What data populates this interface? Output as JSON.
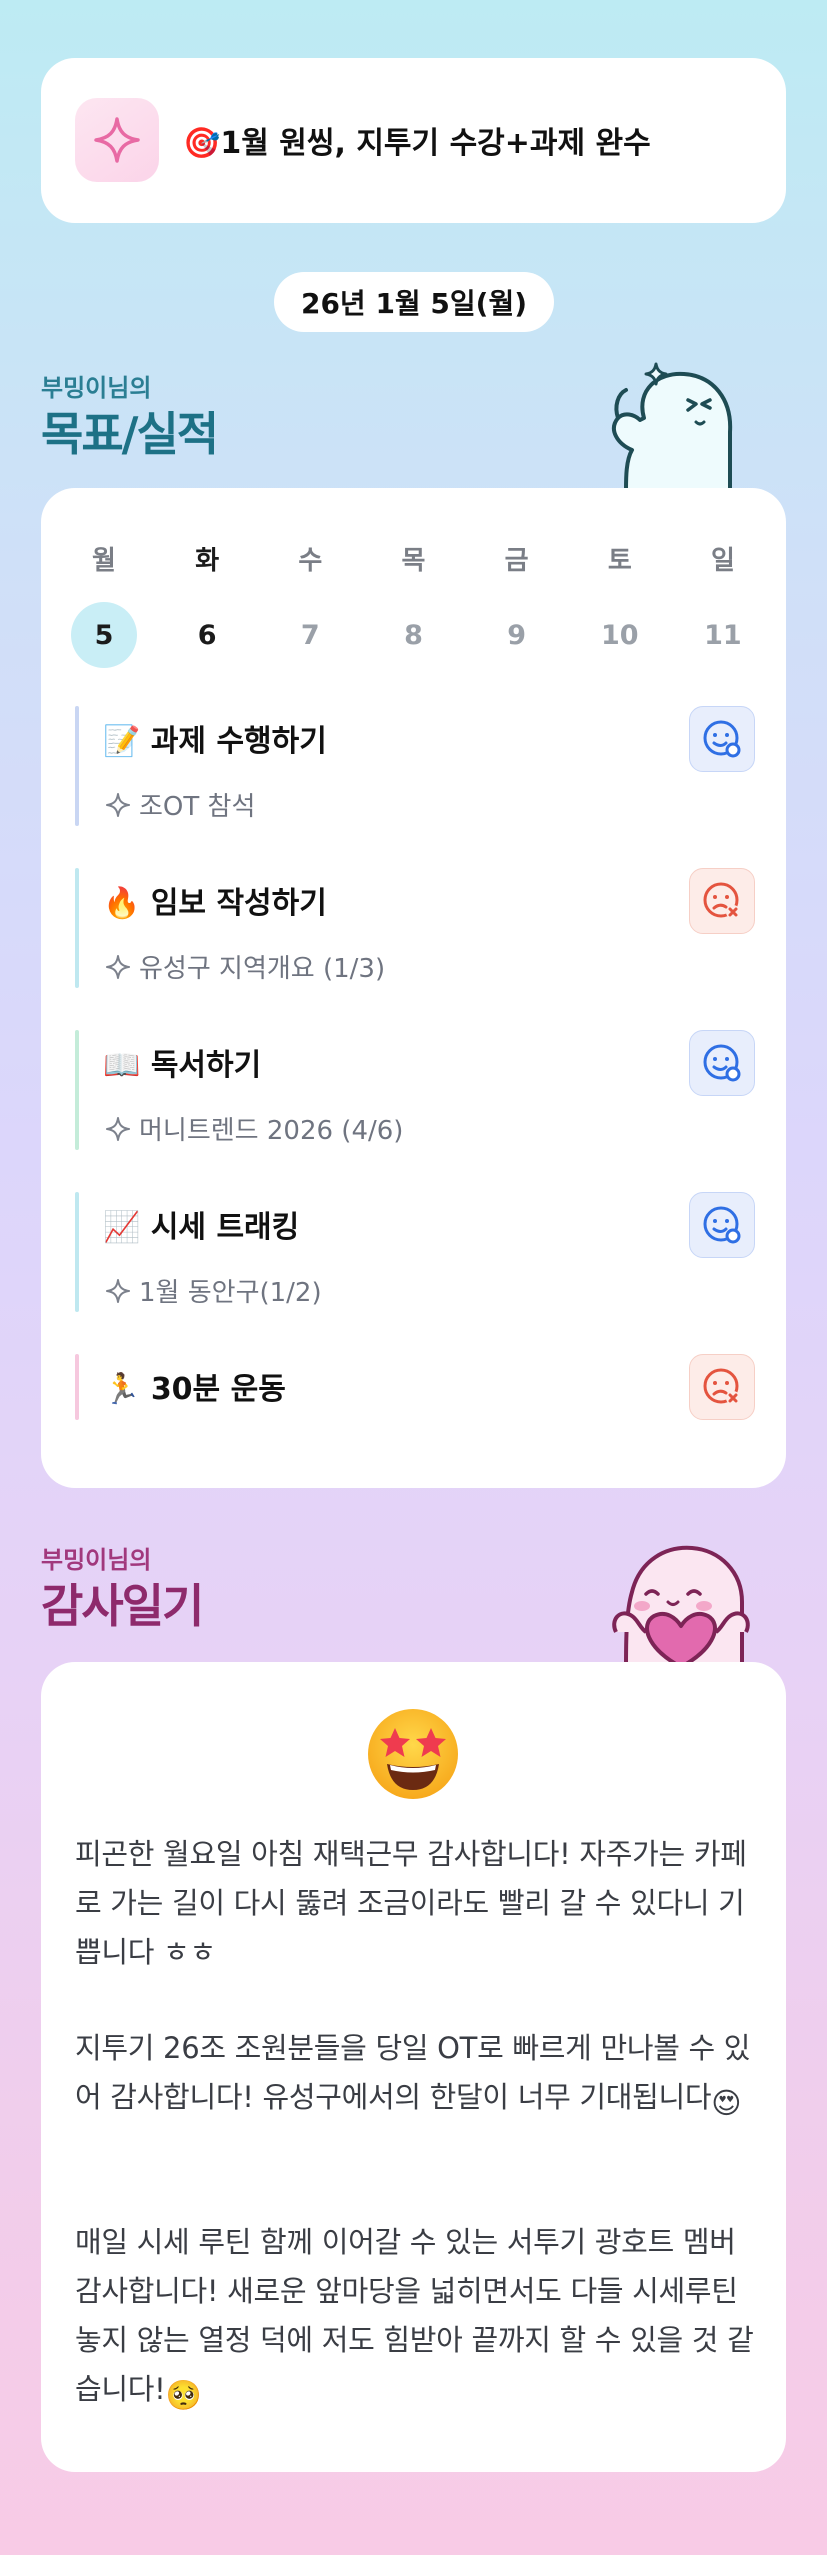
{
  "goal": {
    "icon": "sparkle-icon",
    "emoji": "🎯",
    "text": "1월 원씽, 지투기 수강+과제 완수"
  },
  "date": "26년 1월 5일(월)",
  "goals_section": {
    "owner": "부밍이님의",
    "title": "목표/실적"
  },
  "week": [
    {
      "day": "월",
      "date": "5"
    },
    {
      "day": "화",
      "date": "6"
    },
    {
      "day": "수",
      "date": "7"
    },
    {
      "day": "목",
      "date": "8"
    },
    {
      "day": "금",
      "date": "9"
    },
    {
      "day": "토",
      "date": "10"
    },
    {
      "day": "일",
      "date": "11"
    }
  ],
  "tasks": [
    {
      "emoji": "📝",
      "title": "과제 수행하기",
      "detail": "조OT 참석",
      "status": "success",
      "bar_color": "#c9d6f3"
    },
    {
      "emoji": "🔥",
      "title": "임보 작성하기",
      "detail": "유성구 지역개요 (1/3)",
      "status": "fail",
      "bar_color": "#bfe8f0"
    },
    {
      "emoji": "📖",
      "title": "독서하기",
      "detail": "머니트렌드 2026 (4/6)",
      "status": "success",
      "bar_color": "#c4ecd9"
    },
    {
      "emoji": "📈",
      "title": "시세 트래킹",
      "detail": "1월 동안구(1/2)",
      "status": "success",
      "bar_color": "#bfe8f0"
    },
    {
      "emoji": "🏃",
      "title": "30분 운동",
      "detail": "",
      "status": "fail",
      "bar_color": "#f6c8de"
    }
  ],
  "status_icons": {
    "success": "smile-check-icon",
    "fail": "frown-x-icon"
  },
  "gratitude_section": {
    "owner": "부밍이님의",
    "title": "감사일기",
    "emoji": "🤩",
    "paragraphs": [
      {
        "text": "피곤한 월요일 아침 재택근무 감사합니다! 자주가는 카페로 가는 길이 다시 뚫려 조금이라도 빨리 갈 수 있다니 기쁩니다 ㅎㅎ",
        "emoji": ""
      },
      {
        "text": "지투기 26조 조원분들을 당일 OT로 빠르게 만나볼 수 있어 감사합니다! 유성구에서의 한달이 너무 기대됩니다",
        "emoji": "😍"
      },
      {
        "text": "매일 시세 루틴 함께 이어갈 수 있는 서투기 광호트 멤버 감사합니다! 새로운 앞마당을 넓히면서도 다들 시세루틴 놓지 않는 열정 덕에 저도 힘받아 끝까지 할 수 있을 것 같습니다!",
        "emoji": "🥺"
      }
    ]
  },
  "colors": {
    "goal_title": "#1d7186",
    "gratitude_title": "#8e2a6c",
    "today_circle": "#c9eef6",
    "success_icon": "#2f6fe4",
    "fail_icon": "#e4543f"
  }
}
